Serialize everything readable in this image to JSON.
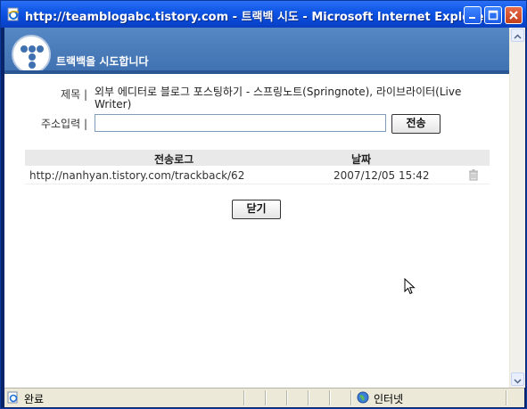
{
  "window": {
    "title": "http://teamblogabc.tistory.com - 트랙백 시도 - Microsoft Internet Explorer",
    "icon": "ie-page-icon",
    "controls": [
      "minimize-icon",
      "maximize-icon",
      "close-icon"
    ]
  },
  "header": {
    "title": "트랙백을 시도합니다",
    "logo": "tistory-logo"
  },
  "form": {
    "title_label": "제목 |",
    "title_value_line1": "외부 에디터로 블로그 포스팅하기 - 스프링노트(Springnote), 라이브라이터(Live",
    "title_value_line2": "Writer)",
    "address_label": "주소입력 |",
    "address_value": "",
    "send_label": "전송"
  },
  "log_table": {
    "columns": [
      "전송로그",
      "날짜"
    ],
    "rows": [
      {
        "url": "http://nanhyan.tistory.com/trackback/62",
        "date": "2007/12/05 15:42",
        "action_icon": "trash-icon"
      }
    ]
  },
  "close_label": "닫기",
  "status": {
    "text": "완료",
    "zone": "인터넷",
    "zone_icon": "globe-icon"
  },
  "colors": {
    "titlebar": "#0a52e0",
    "header": "#4a7dbd",
    "status_bar": "#ece9d8"
  }
}
